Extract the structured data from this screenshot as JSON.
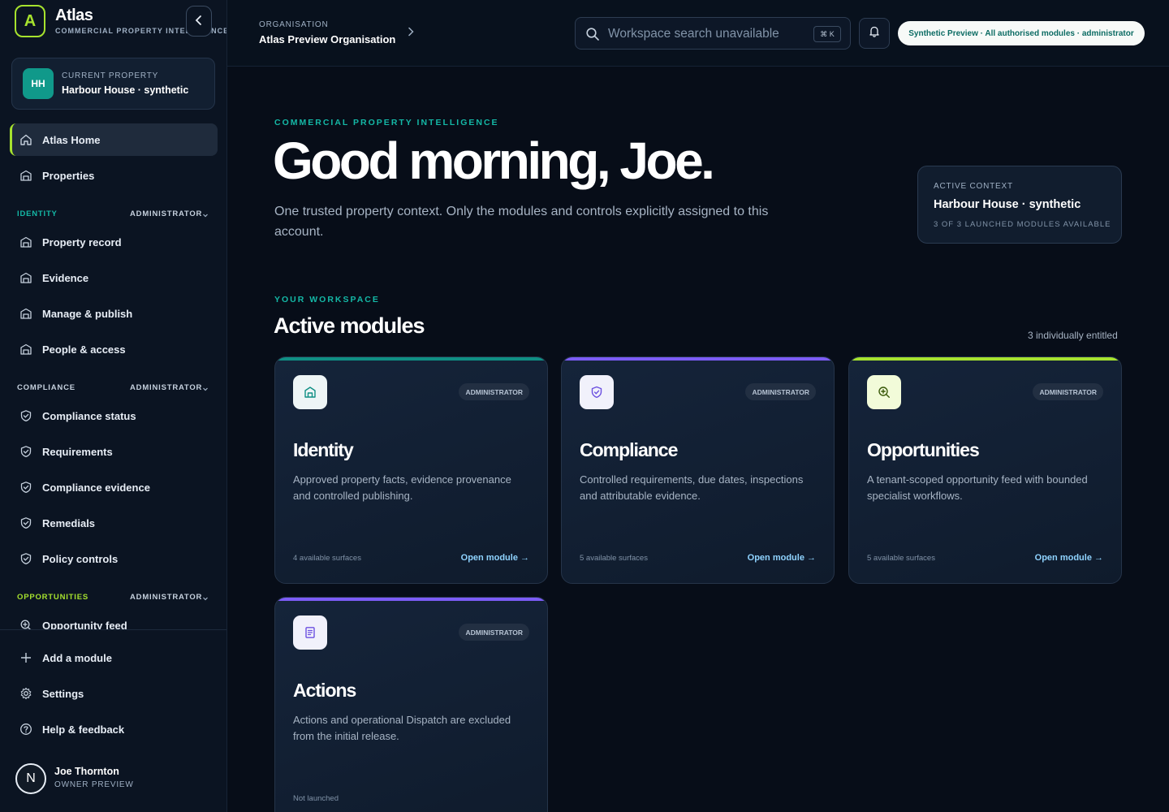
{
  "brand": {
    "logo_letter": "A",
    "name": "Atlas",
    "tagline": "COMMERCIAL PROPERTY INTELLIGENCE"
  },
  "property": {
    "initials": "HH",
    "label": "CURRENT PROPERTY",
    "name": "Harbour House · synthetic"
  },
  "nav": {
    "home": "Atlas Home",
    "properties": "Properties",
    "sections": [
      {
        "title": "IDENTITY",
        "role": "ADMINISTRATOR",
        "color": "#14b8a6",
        "items": [
          "Property record",
          "Evidence",
          "Manage & publish",
          "People & access"
        ]
      },
      {
        "title": "COMPLIANCE",
        "role": "ADMINISTRATOR",
        "color": "#c5d0dd",
        "items": [
          "Compliance status",
          "Requirements",
          "Compliance evidence",
          "Remedials",
          "Policy controls"
        ]
      },
      {
        "title": "OPPORTUNITIES",
        "role": "ADMINISTRATOR",
        "color": "#a6e22e",
        "items": [
          "Opportunity feed"
        ]
      }
    ],
    "footer": [
      "Add a module",
      "Settings",
      "Help & feedback"
    ]
  },
  "user": {
    "avatar_letter": "N",
    "name": "Joe Thornton",
    "role": "OWNER PREVIEW"
  },
  "topbar": {
    "org_label": "ORGANISATION",
    "org_name": "Atlas Preview Organisation",
    "search_placeholder": "Workspace search unavailable",
    "search_shortcut": "⌘ K",
    "preview_pill": "Synthetic Preview · All authorised modules · administrator"
  },
  "hero": {
    "kicker": "COMMERCIAL PROPERTY INTELLIGENCE",
    "title": "Good morning, Joe.",
    "subtitle": "One trusted property context. Only the modules and controls explicitly assigned to this account."
  },
  "context": {
    "label": "ACTIVE CONTEXT",
    "name": "Harbour House · synthetic",
    "meta": "3 OF 3 LAUNCHED MODULES AVAILABLE"
  },
  "workspace": {
    "kicker": "YOUR WORKSPACE",
    "title": "Active modules",
    "count": "3 individually entitled"
  },
  "modules": [
    {
      "name": "Identity",
      "role": "ADMINISTRATOR",
      "accent": "#0f8f84",
      "icon": "building-icon",
      "description": "Approved property facts, evidence provenance and controlled publishing.",
      "surfaces": "4 available surfaces",
      "open": "Open module →"
    },
    {
      "name": "Compliance",
      "role": "ADMINISTRATOR",
      "accent": "#7c5cf6",
      "icon": "shield-check-icon",
      "description": "Controlled requirements, due dates, inspections and attributable evidence.",
      "surfaces": "5 available surfaces",
      "open": "Open module →"
    },
    {
      "name": "Opportunities",
      "role": "ADMINISTRATOR",
      "accent": "#a6e22e",
      "icon": "search-plus-icon",
      "description": "A tenant-scoped opportunity feed with bounded specialist workflows.",
      "surfaces": "5 available surfaces",
      "open": "Open module →"
    },
    {
      "name": "Actions",
      "role": "ADMINISTRATOR",
      "accent": "#7c5cf6",
      "icon": "document-icon",
      "description": "Actions and operational Dispatch are excluded from the initial release.",
      "surfaces": "Not launched",
      "open": ""
    }
  ]
}
